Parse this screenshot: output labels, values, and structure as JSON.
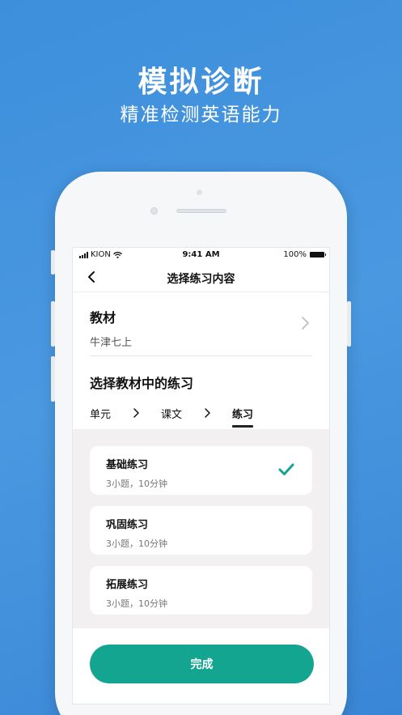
{
  "promo": {
    "title": "模拟诊断",
    "subtitle": "精准检测英语能力"
  },
  "status_bar": {
    "carrier": "KION",
    "time": "9:41 AM",
    "battery": "100%"
  },
  "nav": {
    "title": "选择练习内容",
    "back_icon": "chevron-left-icon"
  },
  "textbook": {
    "label": "教材",
    "value": "牛津七上"
  },
  "exercise_section": {
    "heading": "选择教材中的练习",
    "tabs": [
      {
        "label": "单元",
        "active": false
      },
      {
        "label": "课文",
        "active": false
      },
      {
        "label": "练习",
        "active": true
      }
    ]
  },
  "exercises": [
    {
      "title": "基础练习",
      "meta": "3小题，10分钟",
      "selected": true
    },
    {
      "title": "巩固练习",
      "meta": "3小题，10分钟",
      "selected": false
    },
    {
      "title": "拓展练习",
      "meta": "3小题，10分钟",
      "selected": false
    }
  ],
  "footer": {
    "done_label": "完成"
  },
  "colors": {
    "background": "#3d8fdc",
    "accent": "#14a590",
    "list_background": "#f2f0f1"
  }
}
